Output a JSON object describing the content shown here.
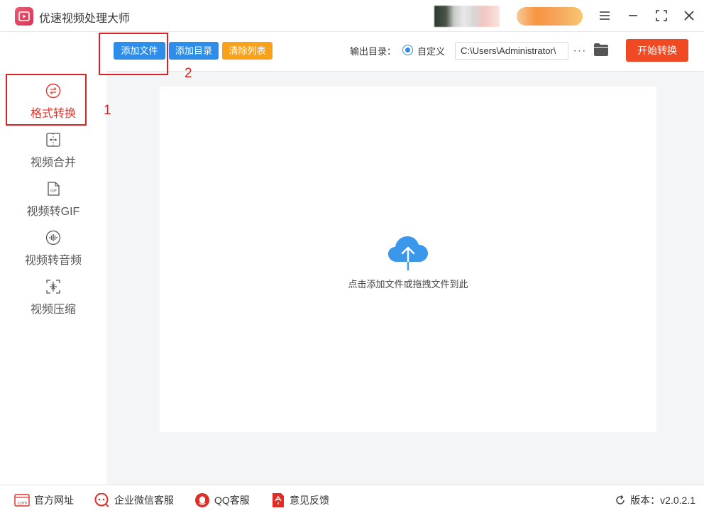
{
  "app": {
    "title": "优速视频处理大师"
  },
  "toolbar": {
    "add_file": "添加文件",
    "add_dir": "添加目录",
    "clear_list": "清除列表",
    "output_label": "输出目录：",
    "radio_label": "自定义",
    "output_path": "C:\\Users\\Administrator\\",
    "more": "···",
    "start": "开始转换"
  },
  "sidebar": {
    "items": [
      {
        "label": "格式转换",
        "icon": "format-convert-icon",
        "active": true
      },
      {
        "label": "视频合并",
        "icon": "video-merge-icon"
      },
      {
        "label": "视频转GIF",
        "icon": "gif-icon"
      },
      {
        "label": "视频转音频",
        "icon": "audio-icon"
      },
      {
        "label": "视频压缩",
        "icon": "compress-icon"
      }
    ]
  },
  "main": {
    "drop_hint": "点击添加文件或拖拽文件到此"
  },
  "annotations": {
    "one": "1",
    "two": "2"
  },
  "footer": {
    "website": "官方网址",
    "wechat": "企业微信客服",
    "qq": "QQ客服",
    "feedback": "意见反馈",
    "version": "版本：v2.0.2.1"
  },
  "colors": {
    "accent_blue": "#2e8de8",
    "accent_orange": "#f7a21a",
    "start_red": "#f04a24",
    "active_red": "#e6322a",
    "annotation_red": "#e02020"
  }
}
